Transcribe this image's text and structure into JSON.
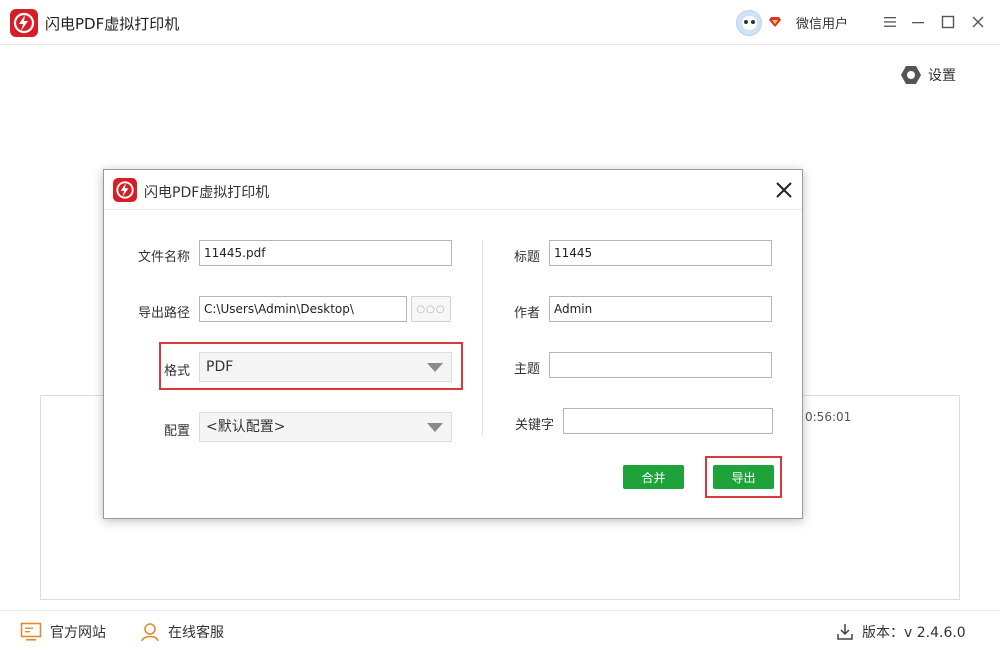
{
  "app": {
    "title": "闪电PDF虚拟打印机"
  },
  "header": {
    "user_name": "微信用户"
  },
  "settings": {
    "label": "设置"
  },
  "background": {
    "time_text": "0:56:01"
  },
  "dialog": {
    "title": "闪电PDF虚拟打印机",
    "fields": {
      "file_name_label": "文件名称",
      "file_name_value": "11445.pdf",
      "export_path_label": "导出路径",
      "export_path_value": "C:\\Users\\Admin\\Desktop\\",
      "browse_label": "○○○",
      "format_label": "格式",
      "format_value": "PDF",
      "config_label": "配置",
      "config_value": "<默认配置>",
      "title_label": "标题",
      "title_value": "11445",
      "author_label": "作者",
      "author_value": "Admin",
      "subject_label": "主题",
      "subject_value": "",
      "keywords_label": "关键字",
      "keywords_value": ""
    },
    "merge_label": "合并",
    "export_label": "导出"
  },
  "footer": {
    "website_label": "官方网站",
    "service_label": "在线客服",
    "version_label": "版本：v 2.4.6.0"
  },
  "colors": {
    "brand_red": "#d71e26",
    "button_green": "#1ea33a",
    "highlight_red": "#d9393b"
  }
}
